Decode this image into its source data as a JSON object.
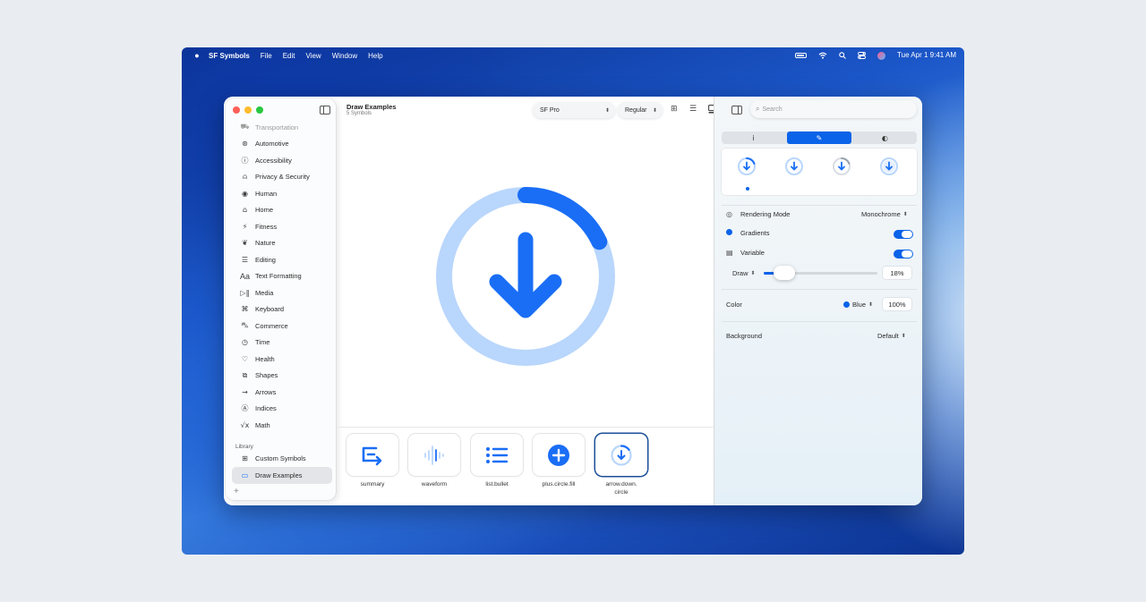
{
  "menubar": {
    "app_name": "SF Symbols",
    "menus": [
      "File",
      "Edit",
      "View",
      "Window",
      "Help"
    ],
    "clock": "Tue Apr 1  9:41 AM"
  },
  "sidebar": {
    "categories": [
      {
        "label": "Transportation",
        "icon": "car-icon"
      },
      {
        "label": "Automotive",
        "icon": "steering-wheel-icon"
      },
      {
        "label": "Accessibility",
        "icon": "accessibility-icon"
      },
      {
        "label": "Privacy & Security",
        "icon": "lock-icon"
      },
      {
        "label": "Human",
        "icon": "person-icon"
      },
      {
        "label": "Home",
        "icon": "house-icon"
      },
      {
        "label": "Fitness",
        "icon": "figure-run-icon"
      },
      {
        "label": "Nature",
        "icon": "leaf-icon"
      },
      {
        "label": "Editing",
        "icon": "sliders-icon"
      },
      {
        "label": "Text Formatting",
        "icon": "textformat-icon"
      },
      {
        "label": "Media",
        "icon": "playpause-icon"
      },
      {
        "label": "Keyboard",
        "icon": "command-icon"
      },
      {
        "label": "Commerce",
        "icon": "cart-icon"
      },
      {
        "label": "Time",
        "icon": "clock-icon"
      },
      {
        "label": "Health",
        "icon": "heart-icon"
      },
      {
        "label": "Shapes",
        "icon": "shapes-icon"
      },
      {
        "label": "Arrows",
        "icon": "arrow-right-icon"
      },
      {
        "label": "Indices",
        "icon": "a-circle-icon"
      },
      {
        "label": "Math",
        "icon": "square-root-icon"
      }
    ],
    "library_heading": "Library",
    "library": [
      {
        "label": "Custom Symbols",
        "icon": "grid-icon"
      },
      {
        "label": "Draw Examples",
        "icon": "folder-icon"
      }
    ]
  },
  "toolbar": {
    "title": "Draw Examples",
    "subtitle": "5 Symbols",
    "font_select": "SF Pro",
    "weight_select": "Regular"
  },
  "gallery": [
    {
      "name": "summary"
    },
    {
      "name": "waveform"
    },
    {
      "name": "list.bullet"
    },
    {
      "name": "plus.circle.fill"
    },
    {
      "name": "arrow.down.\ncircle"
    }
  ],
  "inspector": {
    "search_placeholder": "Search",
    "tabs": [
      "i",
      "paintbrush",
      "toggle"
    ],
    "active_tab_index": 1,
    "rendering_mode_label": "Rendering Mode",
    "rendering_mode_value": "Monochrome",
    "gradients_label": "Gradients",
    "gradients_on": true,
    "variable_label": "Variable",
    "variable_on": true,
    "draw_label": "Draw",
    "draw_percent_text": "18%",
    "draw_fraction": 0.18,
    "color_label": "Color",
    "color_name": "Blue",
    "color_opacity": "100%",
    "background_label": "Background",
    "background_value": "Default"
  },
  "colors": {
    "accent": "#0a63e8",
    "symbol_blue": "#1a6ef5",
    "symbol_light": "#b9d6fc"
  }
}
